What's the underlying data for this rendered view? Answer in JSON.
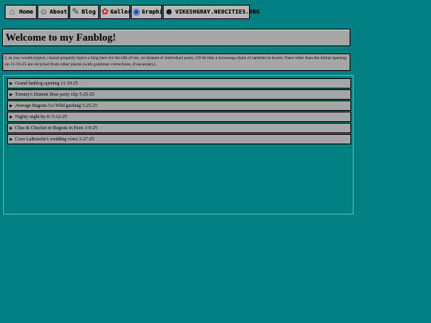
{
  "nav": {
    "home": "Home",
    "about": "About",
    "blog": "Blog",
    "gallery": "Gallery",
    "graphics": "Graphics",
    "site": "VIKESHGRAY.NEOCITIES.ORG"
  },
  "page": {
    "title": "Welcome to my Fanblog!",
    "intro": "I, as you would expect, cannot properly inject a blog here for the life of me, so instead of individual posts, it'll be like a looooong chain of rambles in boxes. Ones older than the initial opening on 11-19-25 are recycled from other places (with grammar corrections, if necessary)."
  },
  "posts": [
    {
      "label": "Grand fanblog opening 11-19-25"
    },
    {
      "label": "Tommy's Dummi Bear party clip 5-25-25"
    },
    {
      "label": "Average Rugrats Go Wild gushing 5-25-25"
    },
    {
      "label": "Nighty night by 6! 5-12-25"
    },
    {
      "label": "Chas & Chuckie in Rugrats in Paris 3-9-25"
    },
    {
      "label": "Coco LaBouche's wedding vows 3-27-25"
    }
  ],
  "colors": {
    "background": "#008080",
    "box": "#a6a6a6"
  }
}
